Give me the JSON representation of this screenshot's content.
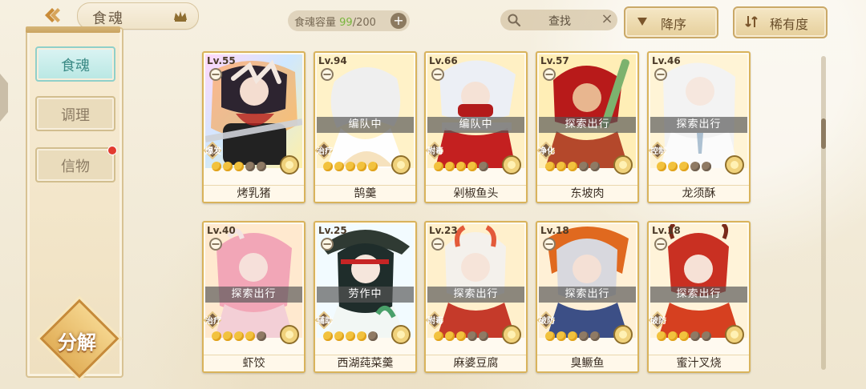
{
  "title": "食魂",
  "capacity": {
    "label": "食魂容量",
    "current": "99",
    "total": "/200"
  },
  "search": {
    "label": "查找"
  },
  "sort": {
    "desc_label": "降序",
    "rarity_label": "稀有度"
  },
  "sidebar": {
    "items": [
      {
        "label": "食魂"
      },
      {
        "label": "调理"
      },
      {
        "label": "信物"
      }
    ]
  },
  "dismantle_label": "分解",
  "cards": [
    {
      "level": "Lv.55",
      "name": "烤乳猪",
      "status": "",
      "role": "爆发"
    },
    {
      "level": "Lv.94",
      "name": "鹄羹",
      "status": "编队中",
      "role": "治疗"
    },
    {
      "level": "Lv.66",
      "name": "剁椒鱼头",
      "status": "编队中",
      "role": "附毒"
    },
    {
      "level": "Lv.57",
      "name": "东坡肉",
      "status": "探索出行",
      "role": "净化"
    },
    {
      "level": "Lv.46",
      "name": "龙须酥",
      "status": "探索出行",
      "role": "控制"
    },
    {
      "level": "Lv.40",
      "name": "虾饺",
      "status": "探索出行",
      "role": "治疗"
    },
    {
      "level": "Lv.25",
      "name": "西湖莼菜羹",
      "status": "劳作中",
      "role": "辅助"
    },
    {
      "level": "Lv.23",
      "name": "麻婆豆腐",
      "status": "探索出行",
      "role": "附毒"
    },
    {
      "level": "Lv.18",
      "name": "臭鳜鱼",
      "status": "探索出行",
      "role": "破防"
    },
    {
      "level": "Lv.18",
      "name": "蜜汁叉烧",
      "status": "探索出行",
      "role": "破防"
    }
  ]
}
